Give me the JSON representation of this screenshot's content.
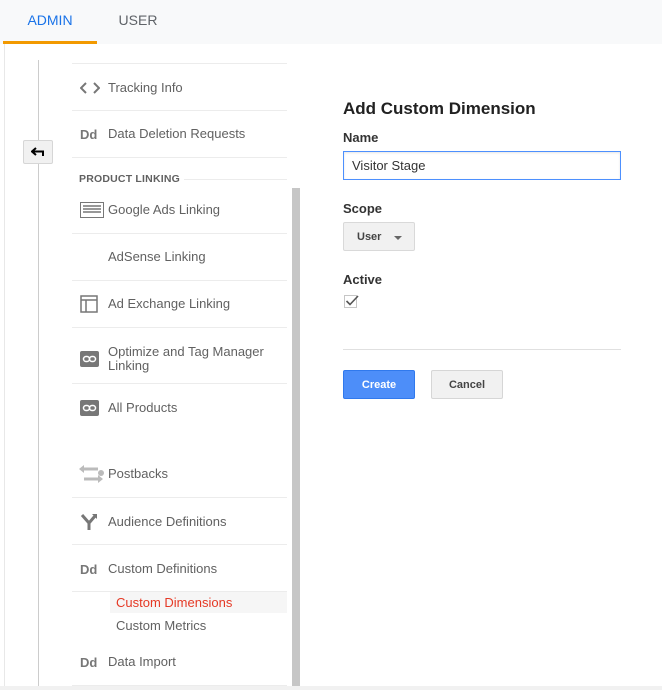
{
  "tabs": [
    {
      "label": "ADMIN",
      "active": true
    },
    {
      "label": "USER",
      "active": false
    }
  ],
  "colors": {
    "accent": "#1a73e8",
    "tab_underline": "#f29900",
    "active_link": "#e53925",
    "primary_button": "#4d8ef9"
  },
  "nav": {
    "items": [
      {
        "label": "Tracking Info",
        "icon": "code-brackets-icon"
      },
      {
        "label": "Data Deletion Requests",
        "icon": "dd-icon"
      },
      {
        "label": "Google Ads Linking",
        "icon": "ads-panel-icon"
      },
      {
        "label": "AdSense Linking",
        "icon": ""
      },
      {
        "label": "Ad Exchange Linking",
        "icon": "layout-icon"
      },
      {
        "label": "Optimize and Tag Manager Linking",
        "icon": "link-icon"
      },
      {
        "label": "All Products",
        "icon": "link-icon"
      },
      {
        "label": "Postbacks",
        "icon": "arrows-exchange-icon"
      },
      {
        "label": "Audience Definitions",
        "icon": "fork-icon"
      },
      {
        "label": "Custom Definitions",
        "icon": "dd-icon"
      },
      {
        "label": "Data Import",
        "icon": "dd-icon"
      }
    ],
    "section_product_linking": "PRODUCT LINKING",
    "sub_items": [
      {
        "label": "Custom Dimensions",
        "active": true
      },
      {
        "label": "Custom Metrics",
        "active": false
      }
    ],
    "dd_glyph": "Dd"
  },
  "form": {
    "title": "Add Custom Dimension",
    "name_label": "Name",
    "name_value": "Visitor Stage",
    "scope_label": "Scope",
    "scope_value": "User",
    "active_label": "Active",
    "active_checked": true,
    "create_label": "Create",
    "cancel_label": "Cancel"
  }
}
